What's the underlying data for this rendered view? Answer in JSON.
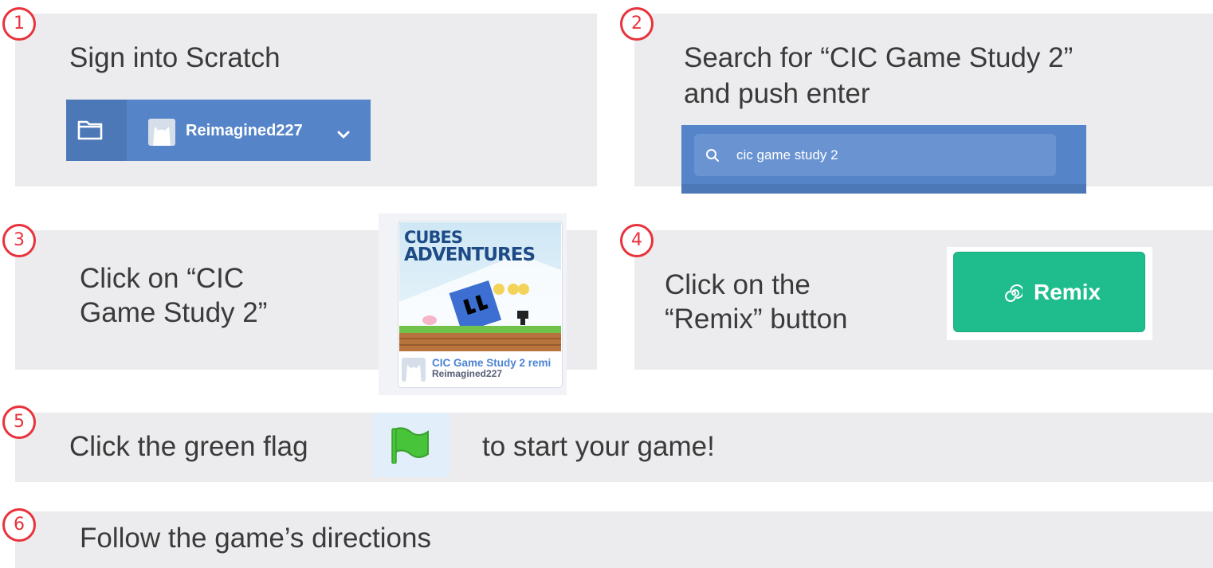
{
  "steps": [
    {
      "number": "1",
      "text": "Sign into Scratch"
    },
    {
      "number": "2",
      "text_line1": "Search for “CIC Game Study 2”",
      "text_line2": "and push enter"
    },
    {
      "number": "3",
      "text_line1": "Click on “CIC",
      "text_line2": "Game Study 2”"
    },
    {
      "number": "4",
      "text_line1": "Click on the",
      "text_line2": "“Remix” button"
    },
    {
      "number": "5",
      "text_before": "Click the green flag",
      "text_after": "to start your game!"
    },
    {
      "number": "6",
      "text": "Follow the game’s directions"
    }
  ],
  "step1_bar": {
    "username": "Reimagined227",
    "icons": [
      "folder-icon",
      "avatar",
      "chevron-down-icon"
    ]
  },
  "step2_search": {
    "query": "cic game study 2",
    "icon": "search-icon"
  },
  "step3_card": {
    "thumbnail_title_line1": "CUBES",
    "thumbnail_title_line2": "ADVENTURES",
    "project_title": "CIC Game Study 2 remi",
    "author": "Reimagined227"
  },
  "step4_button": {
    "label": "Remix",
    "icon": "remix-swirl-icon",
    "color": "#1fbd8d"
  },
  "step5_flag": {
    "icon": "green-flag-icon",
    "color": "#47c43a"
  },
  "colors": {
    "step_circle": "#e8323c",
    "panel": "#ececee",
    "scratch_blue": "#5584c8"
  }
}
